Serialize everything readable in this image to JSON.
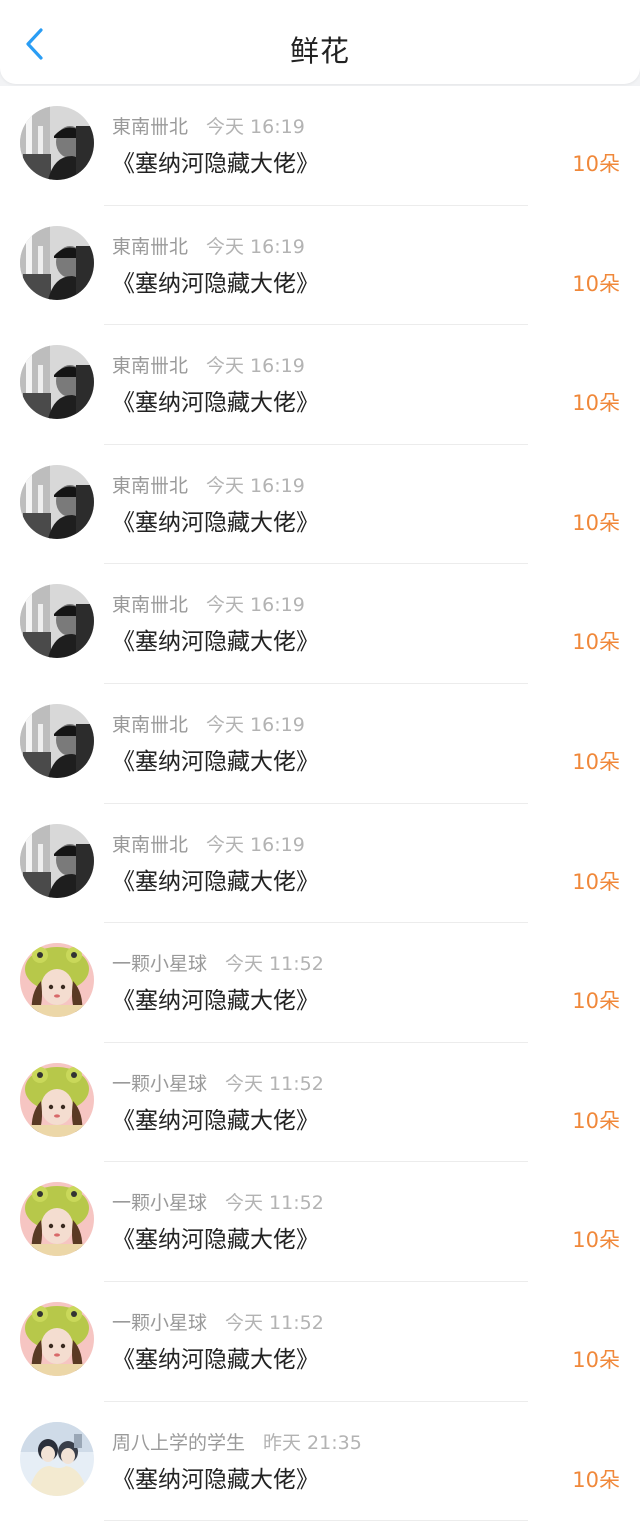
{
  "header": {
    "title": "鲜花",
    "back_icon": "chevron-left-icon",
    "accent_color": "#2a9df4"
  },
  "colors": {
    "amount": "#f0883a",
    "meta": "#9a9a9a",
    "title": "#222222"
  },
  "records": [
    {
      "user": "東南卌北",
      "time": "今天 16:19",
      "book": "《塞纳河隐藏大佬》",
      "amount": "10朵",
      "avatar": "dark-portrait-avatar"
    },
    {
      "user": "東南卌北",
      "time": "今天 16:19",
      "book": "《塞纳河隐藏大佬》",
      "amount": "10朵",
      "avatar": "dark-portrait-avatar"
    },
    {
      "user": "東南卌北",
      "time": "今天 16:19",
      "book": "《塞纳河隐藏大佬》",
      "amount": "10朵",
      "avatar": "dark-portrait-avatar"
    },
    {
      "user": "東南卌北",
      "time": "今天 16:19",
      "book": "《塞纳河隐藏大佬》",
      "amount": "10朵",
      "avatar": "dark-portrait-avatar"
    },
    {
      "user": "東南卌北",
      "time": "今天 16:19",
      "book": "《塞纳河隐藏大佬》",
      "amount": "10朵",
      "avatar": "dark-portrait-avatar"
    },
    {
      "user": "東南卌北",
      "time": "今天 16:19",
      "book": "《塞纳河隐藏大佬》",
      "amount": "10朵",
      "avatar": "dark-portrait-avatar"
    },
    {
      "user": "東南卌北",
      "time": "今天 16:19",
      "book": "《塞纳河隐藏大佬》",
      "amount": "10朵",
      "avatar": "dark-portrait-avatar"
    },
    {
      "user": "一颗小星球",
      "time": "今天 11:52",
      "book": "《塞纳河隐藏大佬》",
      "amount": "10朵",
      "avatar": "frog-hat-girl-avatar"
    },
    {
      "user": "一颗小星球",
      "time": "今天 11:52",
      "book": "《塞纳河隐藏大佬》",
      "amount": "10朵",
      "avatar": "frog-hat-girl-avatar"
    },
    {
      "user": "一颗小星球",
      "time": "今天 11:52",
      "book": "《塞纳河隐藏大佬》",
      "amount": "10朵",
      "avatar": "frog-hat-girl-avatar"
    },
    {
      "user": "一颗小星球",
      "time": "今天 11:52",
      "book": "《塞纳河隐藏大佬》",
      "amount": "10朵",
      "avatar": "frog-hat-girl-avatar"
    },
    {
      "user": "周八上学的学生",
      "time": "昨天 21:35",
      "book": "《塞纳河隐藏大佬》",
      "amount": "10朵",
      "avatar": "light-photo-avatar"
    }
  ]
}
